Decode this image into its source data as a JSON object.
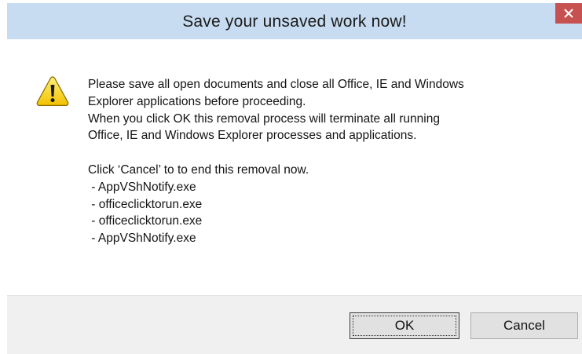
{
  "window": {
    "title": "Save your unsaved work now!",
    "close_icon": "close-icon",
    "titlebar_color": "#c7dcf1",
    "close_color": "#c75050"
  },
  "message": {
    "icon": "warning-icon",
    "lines": [
      "Please save all open documents and close all Office, IE and Windows",
      "Explorer applications before proceeding.",
      "When you click OK this removal process will terminate all running",
      "Office, IE and Windows Explorer processes and applications."
    ],
    "cancel_note": "Click ‘Cancel’ to to end this removal now.",
    "processes": [
      " - AppVShNotify.exe",
      " - officeclicktorun.exe",
      " - officeclicktorun.exe",
      " - AppVShNotify.exe"
    ]
  },
  "buttons": {
    "ok_label": "OK",
    "cancel_label": "Cancel"
  }
}
